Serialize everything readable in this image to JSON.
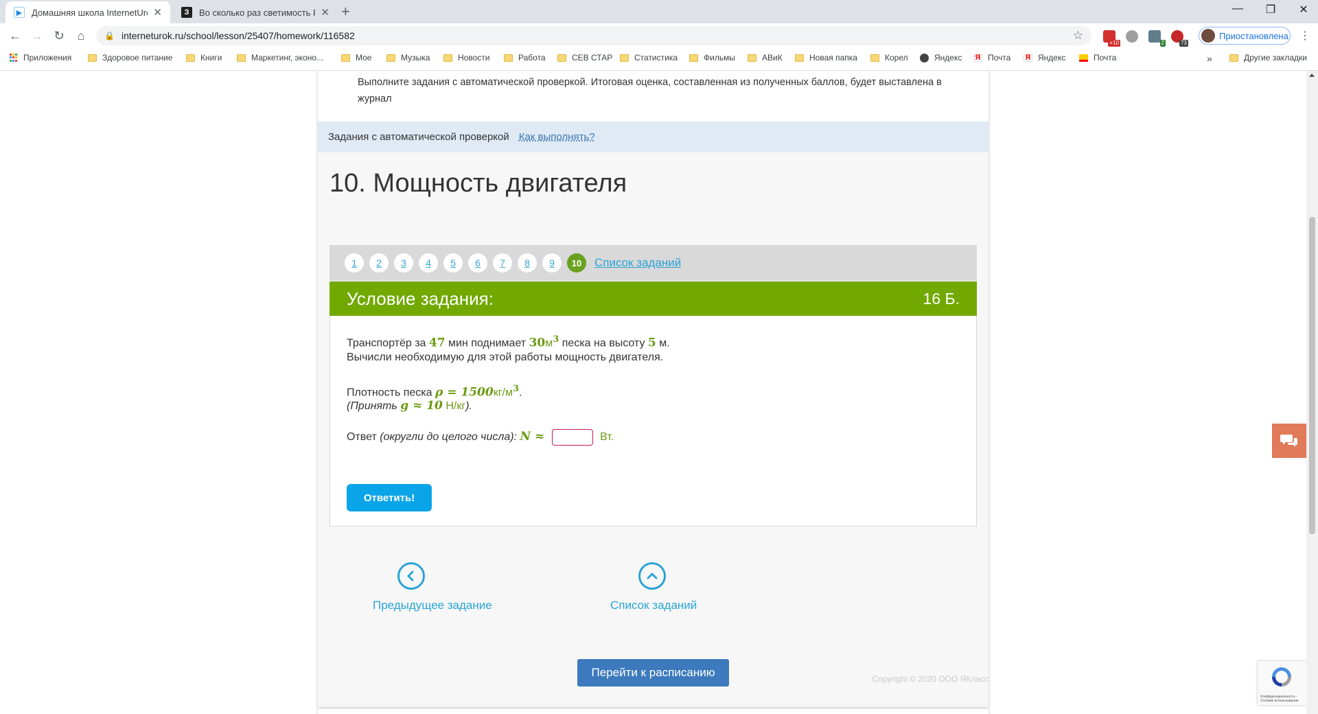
{
  "browser": {
    "tabs": [
      {
        "title": "Домашняя школа InternetUrok.r",
        "favicon": "play-icon",
        "active": true
      },
      {
        "title": "Во сколько раз светимость Риге",
        "favicon": "znanija-icon",
        "active": false
      }
    ],
    "url": "interneturok.ru/school/lesson/25407/homework/116582",
    "profile_label": "Приостановлена",
    "extension_badges": {
      "ext1": "+10",
      "ext3": "2",
      "ext4": "73"
    },
    "bookmarks": [
      {
        "label": "Приложения",
        "icon": "apps-icon"
      },
      {
        "label": "Здоровое питание",
        "icon": "folder-icon"
      },
      {
        "label": "Книги",
        "icon": "folder-icon"
      },
      {
        "label": "Маркетинг, эконо...",
        "icon": "folder-icon"
      },
      {
        "label": "Мое",
        "icon": "folder-icon"
      },
      {
        "label": "Музыка",
        "icon": "folder-icon"
      },
      {
        "label": "Новости",
        "icon": "folder-icon"
      },
      {
        "label": "Работа",
        "icon": "folder-icon"
      },
      {
        "label": "СЕВ СТАР",
        "icon": "folder-icon"
      },
      {
        "label": "Статистика",
        "icon": "folder-icon"
      },
      {
        "label": "Фильмы",
        "icon": "folder-icon"
      },
      {
        "label": "АВиК",
        "icon": "folder-icon"
      },
      {
        "label": "Новая папка",
        "icon": "folder-icon"
      },
      {
        "label": "Корел",
        "icon": "folder-icon"
      },
      {
        "label": "Яндекс",
        "icon": "globe-icon"
      },
      {
        "label": "Почта",
        "icon": "yandex-icon"
      },
      {
        "label": "Яндекс",
        "icon": "yandex-icon"
      },
      {
        "label": "Почта",
        "icon": "mail-icon"
      }
    ],
    "bookmarks_more": "»",
    "other_bookmarks": "Другие закладки"
  },
  "page": {
    "intro_text": "Выполните задания с автоматической проверкой. Итоговая оценка, составленная из полученных баллов, будет выставлена в журнал",
    "auto_check_label": "Задания с автоматической проверкой",
    "how_to_link": "Как выполнять?",
    "lesson_title": "10. Мощность двигателя",
    "pager": {
      "numbers": [
        "1",
        "2",
        "3",
        "4",
        "5",
        "6",
        "7",
        "8",
        "9",
        "10"
      ],
      "current": "10",
      "task_list_link": "Список заданий"
    },
    "task": {
      "header": "Условие задания:",
      "points": "16 Б.",
      "line1": {
        "a": "Транспортёр за",
        "t": "47",
        "b": "мин поднимает",
        "v": "30",
        "vunit": "м",
        "vexp": "3",
        "c": "песка на высоту",
        "h": "5",
        "d": "м."
      },
      "line2": "Вычисли необходимую для этой работы мощность двигателя.",
      "line3": {
        "a": "Плотность песка",
        "rho": "ρ = 1500",
        "unit": "кг/м",
        "exp": "3",
        "end": "."
      },
      "line4": {
        "a": "(Принять",
        "g": "g ≈ 10",
        "unit": "Н/кг",
        "end": ")."
      },
      "answer": {
        "label": "Ответ",
        "hint": "(округли до целого числа):",
        "var": "N ≈",
        "value": "",
        "unit": "Вт."
      },
      "submit": "Ответить!"
    },
    "nav": {
      "prev": "Предыдущее задание",
      "list": "Список заданий"
    },
    "copyright": "Copyright © 2020 ООО ЯКласс",
    "schedule_button": "Перейти к расписанию",
    "recaptcha_text": "Конфиденциальность - Условия использования"
  },
  "colors": {
    "accent_green": "#71a900",
    "link_blue": "#29a3d8",
    "button_blue": "#0aa5e8",
    "schedule_blue": "#3c7abd",
    "chat_orange": "#e07a58"
  }
}
